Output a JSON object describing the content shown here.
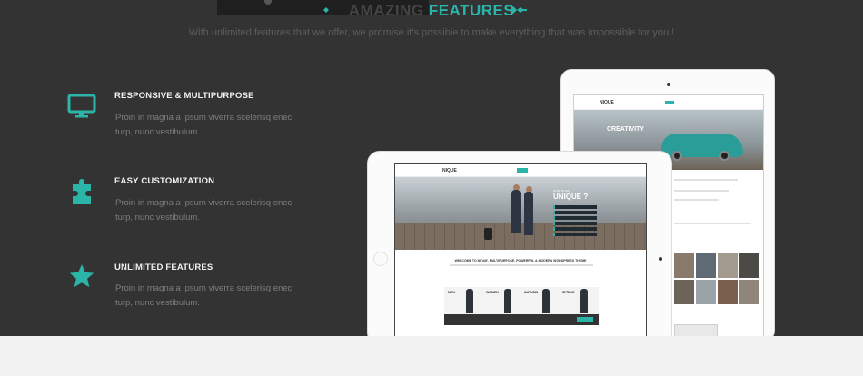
{
  "section": {
    "heading_prefix": "AMAZING ",
    "heading_accent": "FEATURES",
    "subheading": "With unlimited features that we offer, we promise it's possible to make everything that was impossible for you !"
  },
  "features": [
    {
      "icon": "monitor-icon",
      "title": "RESPONSIVE & MULTIPURPOSE",
      "desc": "Proin in magna a ipsum viverra scelerisq enec turp, nunc vestibulum."
    },
    {
      "icon": "puzzle-icon",
      "title": "EASY CUSTOMIZATION",
      "desc": "Proin in magna a ipsum viverra scelerisq enec turp, nunc vestibulum."
    },
    {
      "icon": "star-icon",
      "title": "UNLIMITED FEATURES",
      "desc": "Proin in magna a ipsum viverra scelerisq enec turp, nunc vestibulum."
    }
  ],
  "mockup_front": {
    "logo": "NIQUE",
    "hero_small": "HOW TO SAY",
    "hero_title": "UNIQUE ?",
    "welcome": "WELCOME TO NIQUE, MULTIPURPOSE, POWERFUL & MODERN WORDPRESS THEME",
    "categories": [
      "MEN",
      "WOMEN",
      "AUTUMN",
      "SPRING"
    ]
  },
  "mockup_back": {
    "logo": "NIQUE",
    "hero_title": "CREATIVITY"
  },
  "colors": {
    "accent": "#2bb5a9",
    "background": "#333333",
    "title_text": "#f1f1f1",
    "body_text": "#7e7e7e"
  }
}
